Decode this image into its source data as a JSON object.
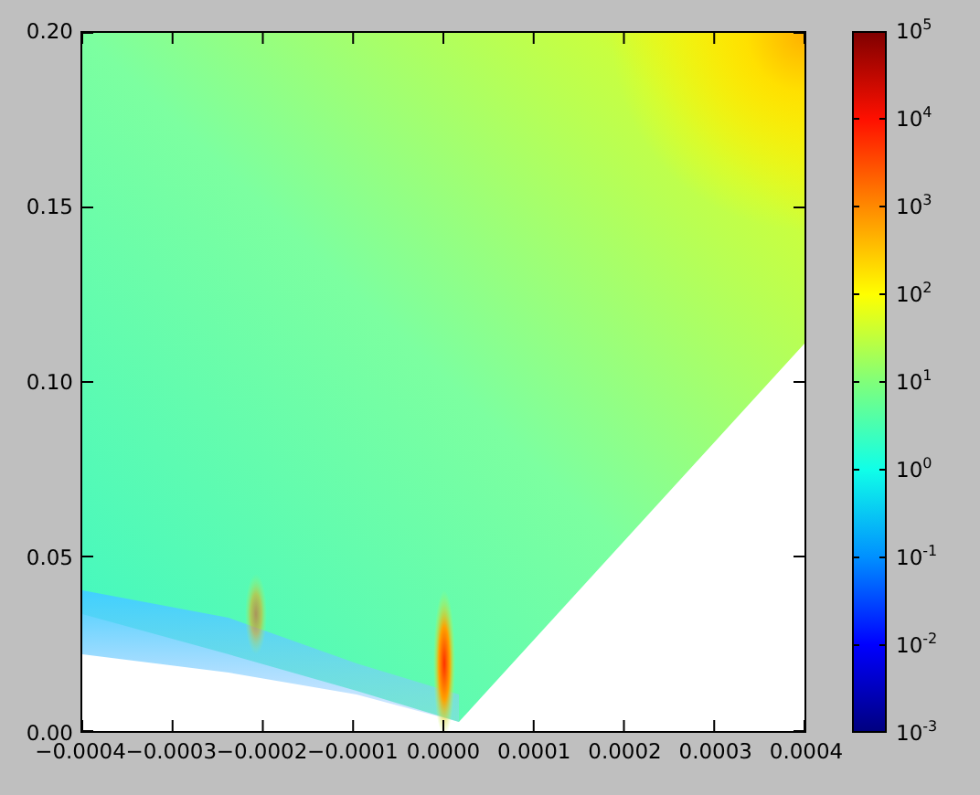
{
  "plot": {
    "y_ticks": [
      "0.20",
      "0.15",
      "0.10",
      "0.05",
      "0.00"
    ],
    "x_ticks": [
      "−0.0004",
      "−0.0003",
      "−0.0002",
      "−0.0001",
      "0.0000",
      "0.0001",
      "0.0002",
      "0.0003",
      "0.0004"
    ]
  },
  "colorbar": {
    "ticks": [
      "10$^{5}$",
      "10$^{4}$",
      "10$^{3}$",
      "10$^{2}$",
      "10$^{1}$",
      "10$^{0}$",
      "10$^{-1}$",
      "10$^{-2}$",
      "10$^{-3}$"
    ]
  }
}
